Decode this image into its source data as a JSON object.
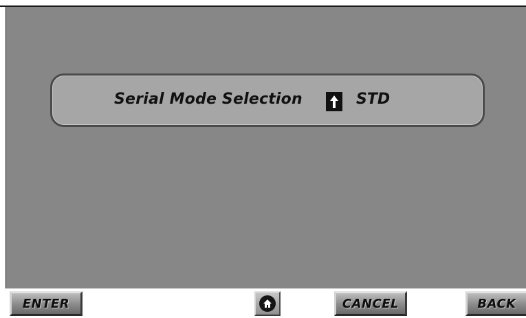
{
  "screen": {
    "background_color": "#878787",
    "panel_color": "#a6a6a6"
  },
  "serial_mode": {
    "label": "Serial Mode Selection",
    "toggle_icon": "up-arrow-icon",
    "value": "STD"
  },
  "footer": {
    "enter_label": "ENTER",
    "home_icon": "home-icon",
    "cancel_label": "CANCEL",
    "back_label": "BACK"
  }
}
